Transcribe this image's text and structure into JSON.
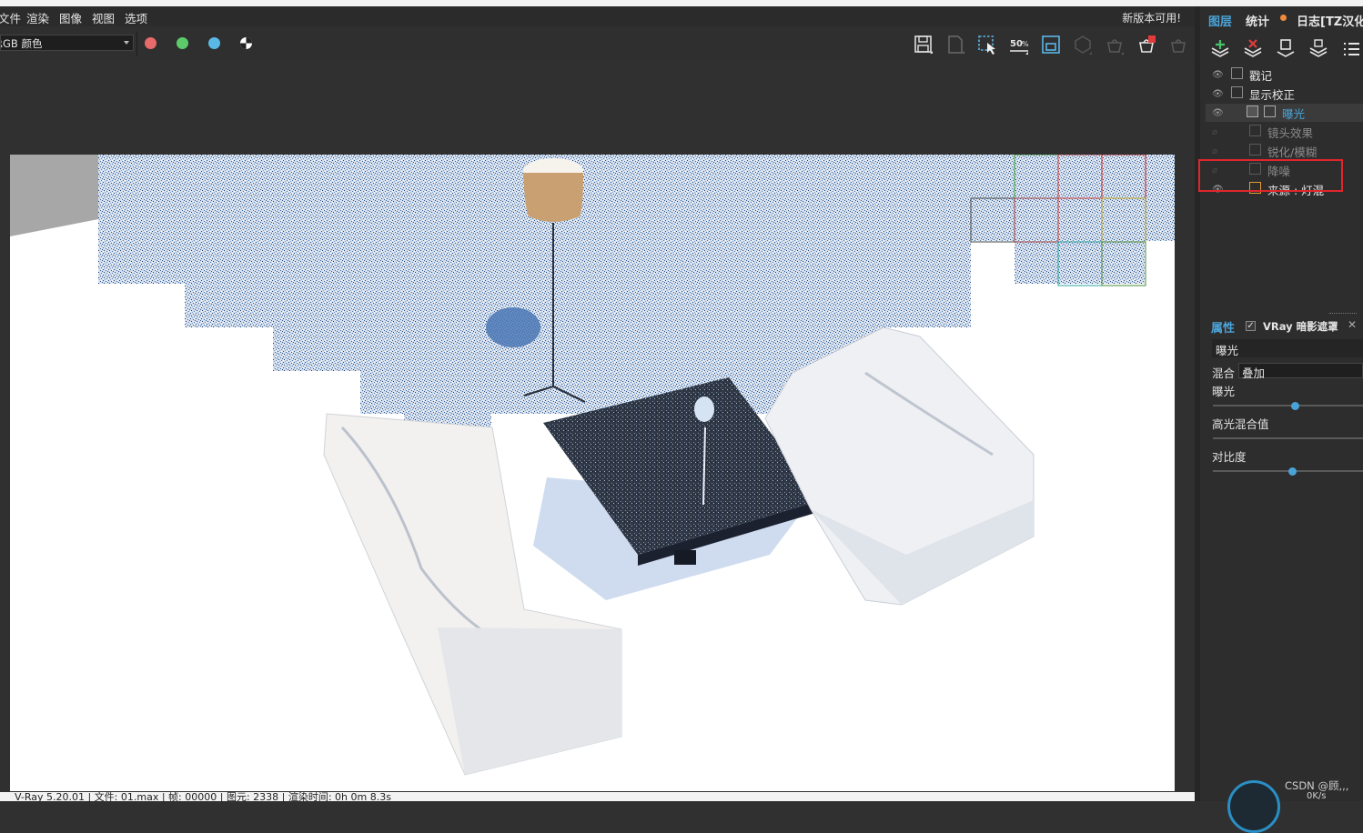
{
  "menu": {
    "items": [
      "文件",
      "渲染",
      "图像",
      "视图",
      "选项"
    ],
    "update_notice": "新版本可用!"
  },
  "toolbar": {
    "channel_value": "RGB 颜色",
    "color_dots": [
      "#e86a6a",
      "#5ccc6a",
      "#5ab8e6"
    ],
    "zoom_label": "50%"
  },
  "panel": {
    "tabs": {
      "layers": "图层",
      "stats": "统计",
      "log": "日志[TZ汉化"
    },
    "layers": [
      {
        "name": "戳记",
        "visible": true,
        "icon": "stamp-icon"
      },
      {
        "name": "显示校正",
        "visible": true,
        "icon": "curve-icon"
      },
      {
        "name": "曝光",
        "visible": true,
        "selected": true,
        "icon": "exposure-icon"
      },
      {
        "name": "镜头效果",
        "visible": false,
        "icon": "lens-icon"
      },
      {
        "name": "锐化/模糊",
        "visible": false,
        "icon": "sharpen-icon"
      },
      {
        "name": "降噪",
        "visible": false,
        "icon": "denoise-icon"
      },
      {
        "name": "来源 : 灯混",
        "visible": true,
        "icon": "source-icon"
      }
    ],
    "props": {
      "tab": "属性",
      "vray_tab": "VRay 暗影遮罩",
      "section_title": "曝光",
      "blend_label": "混合",
      "blend_value": "叠加",
      "exposure_label": "曝光",
      "highlight_label": "高光混合值",
      "contrast_label": "对比度",
      "exposure_level": 0.55,
      "contrast_level": 0.53
    }
  },
  "status": {
    "text": "V-Ray 5.20.01 | 文件: 01.max | 帧: 00000 | 图元: 2338 | 渲染时间: 0h 0m 8.3s"
  },
  "watermark": "CSDN @顾,,,",
  "net_speed": "0K/s",
  "colors": {
    "accent": "#4aa3d8",
    "highlight_box": "#e0262c"
  }
}
